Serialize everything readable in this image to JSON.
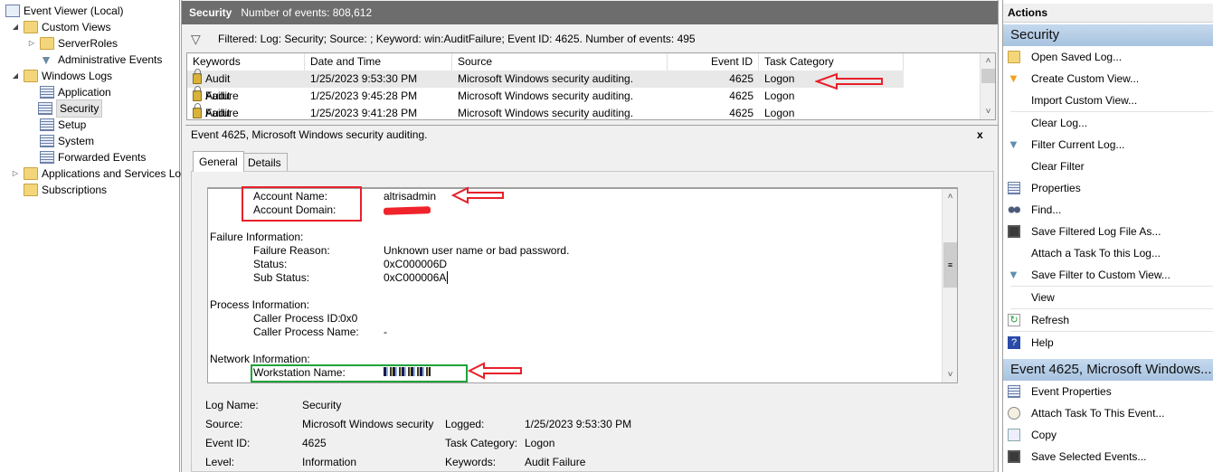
{
  "tree": {
    "items": [
      {
        "label": "Event Viewer (Local)"
      },
      {
        "label": "Custom Views"
      },
      {
        "label": "ServerRoles"
      },
      {
        "label": "Administrative Events"
      },
      {
        "label": "Windows Logs"
      },
      {
        "label": "Application"
      },
      {
        "label": "Security"
      },
      {
        "label": "Setup"
      },
      {
        "label": "System"
      },
      {
        "label": "Forwarded Events"
      },
      {
        "label": "Applications and Services Lo"
      },
      {
        "label": "Subscriptions"
      }
    ]
  },
  "main": {
    "title": "Security",
    "count": "Number of events: 808,612",
    "filter": "Filtered: Log: Security; Source: ; Keyword: win:AuditFailure; Event ID: 4625. Number of events: 495",
    "columns": [
      "Keywords",
      "Date and Time",
      "Source",
      "Event ID",
      "Task Category"
    ],
    "rows": [
      {
        "keyword": "Audit Failure",
        "date": "1/25/2023 9:53:30 PM",
        "source": "Microsoft Windows security auditing.",
        "id": "4625",
        "cat": "Logon"
      },
      {
        "keyword": "Audit Failure",
        "date": "1/25/2023 9:45:28 PM",
        "source": "Microsoft Windows security auditing.",
        "id": "4625",
        "cat": "Logon"
      },
      {
        "keyword": "Audit Failure",
        "date": "1/25/2023 9:41:28 PM",
        "source": "Microsoft Windows security auditing.",
        "id": "4625",
        "cat": "Logon"
      }
    ]
  },
  "detail": {
    "title": "Event 4625, Microsoft Windows security auditing.",
    "close": "x",
    "tabs": [
      "General",
      "Details"
    ],
    "body": {
      "account_name_label": "Account Name:",
      "account_name": "altrisadmin",
      "account_domain_label": "Account Domain:",
      "failure_header": "Failure Information:",
      "failure_reason_label": "Failure Reason:",
      "failure_reason": "Unknown user name or bad password.",
      "status_label": "Status:",
      "status": "0xC000006D",
      "sub_status_label": "Sub Status:",
      "sub_status": "0xC000006A",
      "process_header": "Process Information:",
      "caller_pid_label": "Caller Process ID:",
      "caller_pid": "0x0",
      "caller_name_label": "Caller Process Name:",
      "caller_name": "-",
      "network_header": "Network Information:",
      "workstation_label": "Workstation Name:"
    },
    "info": {
      "log_name_label": "Log Name:",
      "log_name": "Security",
      "source_label": "Source:",
      "source": "Microsoft Windows security",
      "logged_label": "Logged:",
      "logged": "1/25/2023 9:53:30 PM",
      "event_id_label": "Event ID:",
      "event_id": "4625",
      "task_label": "Task Category:",
      "task": "Logon",
      "level_label": "Level:",
      "level": "Information",
      "keywords_label": "Keywords:",
      "keywords": "Audit Failure"
    }
  },
  "actions": {
    "header": "Actions",
    "section1": "Security",
    "items1": [
      "Open Saved Log...",
      "Create Custom View...",
      "Import Custom View...",
      "Clear Log...",
      "Filter Current Log...",
      "Clear Filter",
      "Properties",
      "Find...",
      "Save Filtered Log File As...",
      "Attach a Task To this Log...",
      "Save Filter to Custom View...",
      "View",
      "Refresh",
      "Help"
    ],
    "section2": "Event 4625, Microsoft Windows...",
    "items2": [
      "Event Properties",
      "Attach Task To This Event...",
      "Copy",
      "Save Selected Events..."
    ]
  },
  "colors": {
    "annotation_red": "#e8202a",
    "annotation_green": "#1fa33a",
    "header_gray": "#6d6d6d"
  }
}
